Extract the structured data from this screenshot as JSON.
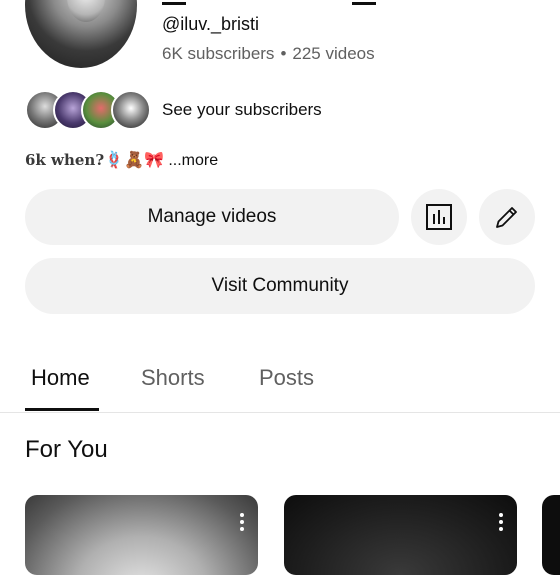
{
  "channel": {
    "handle": "@iluv._bristi",
    "subscribers": "6K subscribers",
    "separator": "•",
    "videos": "225 videos"
  },
  "subscribers_row": {
    "label": "See your subscribers"
  },
  "description": {
    "text": "6k when?",
    "emoji": "🪢🧸🎀",
    "more": "...more"
  },
  "actions": {
    "manage_videos": "Manage videos",
    "visit_community": "Visit Community",
    "analytics_icon": "analytics-icon",
    "edit_icon": "pencil-icon"
  },
  "tabs": [
    {
      "label": "Home",
      "active": true
    },
    {
      "label": "Shorts",
      "active": false
    },
    {
      "label": "Posts",
      "active": false
    }
  ],
  "section": {
    "title": "For You"
  }
}
